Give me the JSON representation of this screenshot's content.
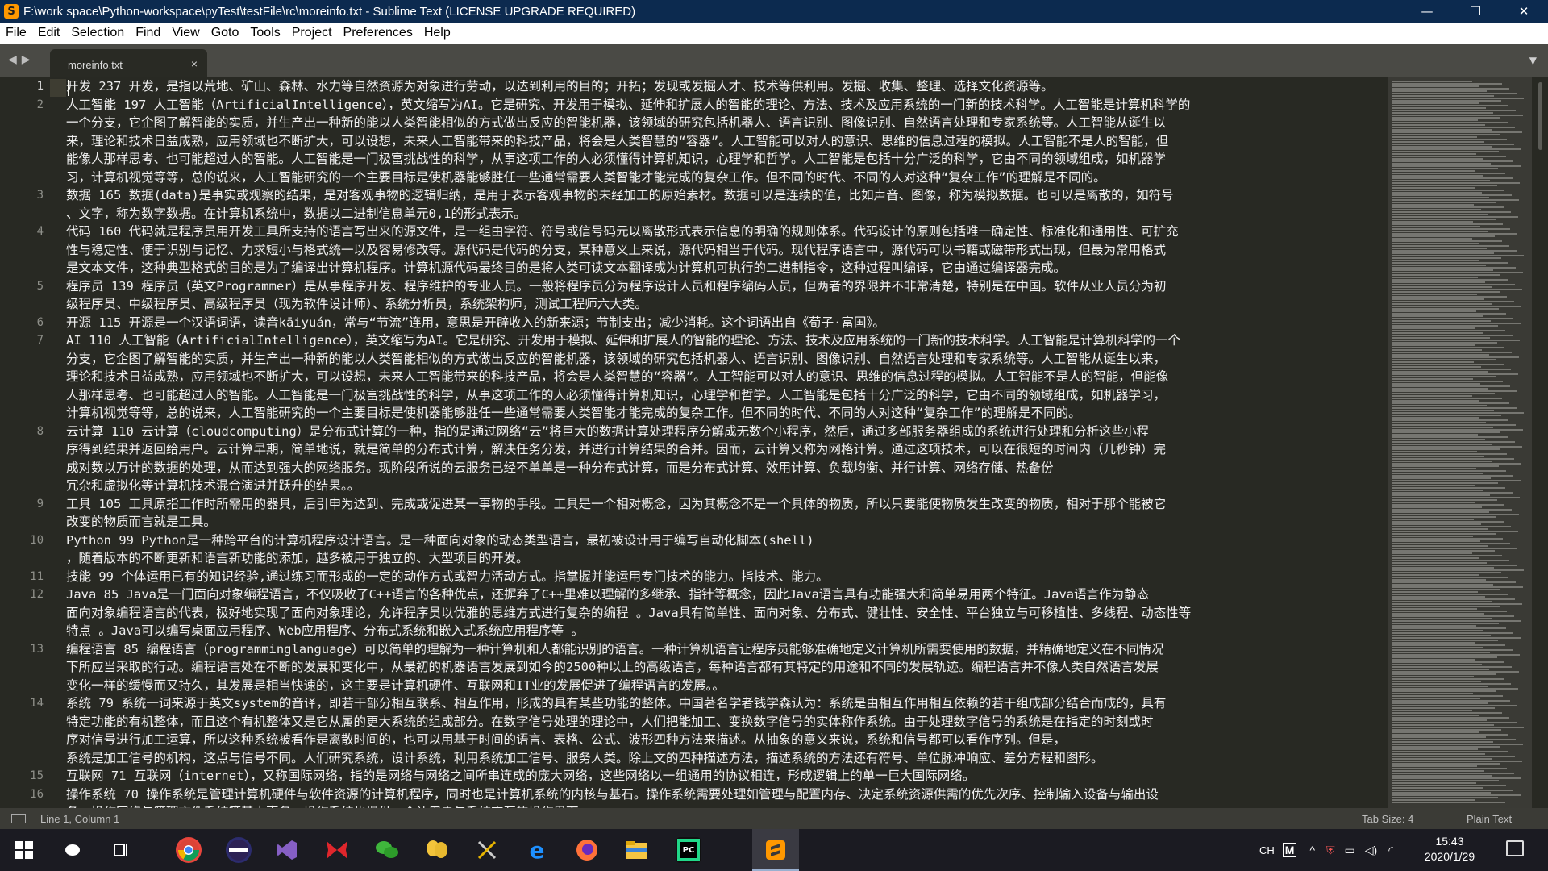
{
  "window": {
    "title": "F:\\work space\\Python-workspace\\pyTest\\testFile\\rc\\moreinfo.txt - Sublime Text (LICENSE UPGRADE REQUIRED)",
    "controls": {
      "minimize": "—",
      "restore": "❐",
      "close": "✕"
    }
  },
  "menu": [
    "File",
    "Edit",
    "Selection",
    "Find",
    "View",
    "Goto",
    "Tools",
    "Project",
    "Preferences",
    "Help"
  ],
  "tab": {
    "name": "moreinfo.txt",
    "close": "×"
  },
  "editor": {
    "lines": [
      {
        "n": "1",
        "rows": [
          "开发 237 开发，是指以荒地、矿山、森林、水力等自然资源为对象进行劳动，以达到利用的目的；开拓；发现或发掘人才、技术等供利用。发掘、收集、整理、选择文化资源等。"
        ]
      },
      {
        "n": "2",
        "rows": [
          "人工智能 197 人工智能（ArtificialIntelligence），英文缩写为AI。它是研究、开发用于模拟、延伸和扩展人的智能的理论、方法、技术及应用系统的一门新的技术科学。人工智能是计算机科学的",
          "一个分支，它企图了解智能的实质，并生产出一种新的能以人类智能相似的方式做出反应的智能机器，该领域的研究包括机器人、语言识别、图像识别、自然语言处理和专家系统等。人工智能从诞生以",
          "来，理论和技术日益成熟，应用领域也不断扩大，可以设想，未来人工智能带来的科技产品，将会是人类智慧的“容器”。人工智能可以对人的意识、思维的信息过程的模拟。人工智能不是人的智能，但",
          "能像人那样思考、也可能超过人的智能。人工智能是一门极富挑战性的科学，从事这项工作的人必须懂得计算机知识，心理学和哲学。人工智能是包括十分广泛的科学，它由不同的领域组成，如机器学",
          "习，计算机视觉等等，总的说来，人工智能研究的一个主要目标是使机器能够胜任一些通常需要人类智能才能完成的复杂工作。但不同的时代、不同的人对这种“复杂工作”的理解是不同的。"
        ]
      },
      {
        "n": "3",
        "rows": [
          "数据 165 数据(data)是事实或观察的结果，是对客观事物的逻辑归纳，是用于表示客观事物的未经加工的原始素材。数据可以是连续的值，比如声音、图像，称为模拟数据。也可以是离散的，如符号",
          "、文字，称为数字数据。在计算机系统中，数据以二进制信息单元0,1的形式表示。"
        ]
      },
      {
        "n": "4",
        "rows": [
          "代码 160 代码就是程序员用开发工具所支持的语言写出来的源文件，是一组由字符、符号或信号码元以离散形式表示信息的明确的规则体系。代码设计的原则包括唯一确定性、标准化和通用性、可扩充",
          "性与稳定性、便于识别与记忆、力求短小与格式统一以及容易修改等。源代码是代码的分支，某种意义上来说，源代码相当于代码。现代程序语言中，源代码可以书籍或磁带形式出现，但最为常用格式",
          "是文本文件，这种典型格式的目的是为了编译出计算机程序。计算机源代码最终目的是将人类可读文本翻译成为计算机可执行的二进制指令，这种过程叫编译，它由通过编译器完成。"
        ]
      },
      {
        "n": "5",
        "rows": [
          "程序员  139 程序员（英文Programmer）是从事程序开发、程序维护的专业人员。一般将程序员分为程序设计人员和程序编码人员，但两者的界限并不非常清楚，特别是在中国。软件从业人员分为初",
          "级程序员、中级程序员、高级程序员（现为软件设计师）、系统分析员，系统架构师，测试工程师六大类。"
        ]
      },
      {
        "n": "6",
        "rows": [
          "开源 115 开源是一个汉语词语，读音kāiyuán，常与“节流”连用，意思是开辟收入的新来源；节制支出；减少消耗。这个词语出自《荀子·富国》。"
        ]
      },
      {
        "n": "7",
        "rows": [
          "AI  110 人工智能（ArtificialIntelligence），英文缩写为AI。它是研究、开发用于模拟、延伸和扩展人的智能的理论、方法、技术及应用系统的一门新的技术科学。人工智能是计算机科学的一个",
          "分支，它企图了解智能的实质，并生产出一种新的能以人类智能相似的方式做出反应的智能机器，该领域的研究包括机器人、语言识别、图像识别、自然语言处理和专家系统等。人工智能从诞生以来，",
          "理论和技术日益成熟，应用领域也不断扩大，可以设想，未来人工智能带来的科技产品，将会是人类智慧的“容器”。人工智能可以对人的意识、思维的信息过程的模拟。人工智能不是人的智能，但能像",
          "人那样思考、也可能超过人的智能。人工智能是一门极富挑战性的科学，从事这项工作的人必须懂得计算机知识，心理学和哲学。人工智能是包括十分广泛的科学，它由不同的领域组成，如机器学习，",
          "计算机视觉等等，总的说来，人工智能研究的一个主要目标是使机器能够胜任一些通常需要人类智能才能完成的复杂工作。但不同的时代、不同的人对这种“复杂工作”的理解是不同的。"
        ]
      },
      {
        "n": "8",
        "rows": [
          "云计算  110 云计算（cloudcomputing）是分布式计算的一种，指的是通过网络“云”将巨大的数据计算处理程序分解成无数个小程序，然后，通过多部服务器组成的系统进行处理和分析这些小程",
          "序得到结果并返回给用户。云计算早期，简单地说，就是简单的分布式计算，解决任务分发，并进行计算结果的合并。因而，云计算又称为网格计算。通过这项技术，可以在很短的时间内（几秒钟）完",
          "成对数以万计的数据的处理，从而达到强大的网络服务。现阶段所说的云服务已经不单单是一种分布式计算，而是分布式计算、效用计算、负载均衡、并行计算、网络存储、热备份",
          "冗杂和虚拟化等计算机技术混合演进并跃升的结果。。"
        ]
      },
      {
        "n": "9",
        "rows": [
          "工具 105 工具原指工作时所需用的器具，后引申为达到、完成或促进某一事物的手段。工具是一个相对概念，因为其概念不是一个具体的物质，所以只要能使物质发生改变的物质，相对于那个能被它",
          "改变的物质而言就是工具。"
        ]
      },
      {
        "n": "10",
        "rows": [
          "Python  99  Python是一种跨平台的计算机程序设计语言。是一种面向对象的动态类型语言，最初被设计用于编写自动化脚本(shell)",
          "，随着版本的不断更新和语言新功能的添加，越多被用于独立的、大型项目的开发。"
        ]
      },
      {
        "n": "11",
        "rows": [
          "技能 99  个体运用已有的知识经验,通过练习而形成的一定的动作方式或智力活动方式。指掌握并能运用专门技术的能力。指技术、能力。"
        ]
      },
      {
        "n": "12",
        "rows": [
          "Java    85  Java是一门面向对象编程语言，不仅吸收了C++语言的各种优点，还摒弃了C++里难以理解的多继承、指针等概念，因此Java语言具有功能强大和简单易用两个特征。Java语言作为静态",
          "面向对象编程语言的代表，极好地实现了面向对象理论，允许程序员以优雅的思维方式进行复杂的编程 。Java具有简单性、面向对象、分布式、健壮性、安全性、平台独立与可移植性、多线程、动态性等",
          "特点 。Java可以编写桌面应用程序、Web应用程序、分布式系统和嵌入式系统应用程序等 。"
        ]
      },
      {
        "n": "13",
        "rows": [
          "编程语言 85  编程语言（programminglanguage）可以简单的理解为一种计算机和人都能识别的语言。一种计算机语言让程序员能够准确地定义计算机所需要使用的数据，并精确地定义在不同情况",
          "下所应当采取的行动。编程语言处在不断的发展和变化中，从最初的机器语言发展到如今的2500种以上的高级语言，每种语言都有其特定的用途和不同的发展轨迹。编程语言并不像人类自然语言发展",
          "变化一样的缓慢而又持久，其发展是相当快速的，这主要是计算机硬件、互联网和IT业的发展促进了编程语言的发展。。"
        ]
      },
      {
        "n": "14",
        "rows": [
          "系统 79  系统一词来源于英文system的音译，即若干部分相互联系、相互作用，形成的具有某些功能的整体。中国著名学者钱学森认为：系统是由相互作用相互依赖的若干组成部分结合而成的，具有",
          "特定功能的有机整体，而且这个有机整体又是它从属的更大系统的组成部分。在数字信号处理的理论中，人们把能加工、变换数字信号的实体称作系统。由于处理数字信号的系统是在指定的时刻或时",
          "序对信号进行加工运算，所以这种系统被看作是离散时间的，也可以用基于时间的语言、表格、公式、波形四种方法来描述。从抽象的意义来说，系统和信号都可以看作序列。但是，",
          "系统是加工信号的机构，这点与信号不同。人们研究系统，设计系统，利用系统加工信号、服务人类。除上文的四种描述方法，描述系统的方法还有符号、单位脉冲响应、差分方程和图形。"
        ]
      },
      {
        "n": "15",
        "rows": [
          "互联网  71  互联网（internet），又称国际网络，指的是网络与网络之间所串连成的庞大网络，这些网络以一组通用的协议相连，形成逻辑上的单一巨大国际网络。"
        ]
      },
      {
        "n": "16",
        "rows": [
          "操作系统 70  操作系统是管理计算机硬件与软件资源的计算机程序，同时也是计算机系统的内核与基石。操作系统需要处理如管理与配置内存、决定系统资源供需的优先次序、控制输入设备与输出设",
          "备、操作网络与管理文件系统等基本事务。操作系统也提供一个让用户与系统交互的操作界面。"
        ]
      }
    ]
  },
  "status": {
    "position": "Line 1, Column 1",
    "tab_size": "Tab Size: 4",
    "syntax": "Plain Text"
  },
  "taskbar": {
    "clock_time": "15:43",
    "clock_date": "2020/1/29",
    "ime": "CH",
    "ime_mode": "M"
  }
}
